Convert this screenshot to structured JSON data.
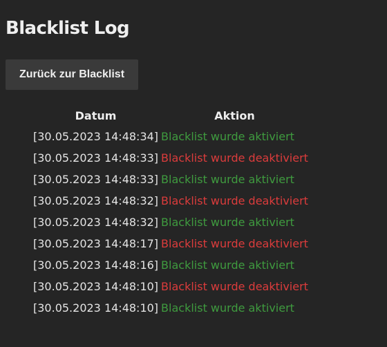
{
  "page": {
    "title": "Blacklist Log",
    "back_button_label": "Zurück zur Blacklist"
  },
  "table": {
    "headers": {
      "datum": "Datum",
      "aktion": "Aktion"
    },
    "rows": [
      {
        "timestamp": "[30.05.2023 14:48:34]",
        "action": "Blacklist wurde aktiviert",
        "status": "on"
      },
      {
        "timestamp": "[30.05.2023 14:48:33]",
        "action": "Blacklist wurde deaktiviert",
        "status": "off"
      },
      {
        "timestamp": "[30.05.2023 14:48:33]",
        "action": "Blacklist wurde aktiviert",
        "status": "on"
      },
      {
        "timestamp": "[30.05.2023 14:48:32]",
        "action": "Blacklist wurde deaktiviert",
        "status": "off"
      },
      {
        "timestamp": "[30.05.2023 14:48:32]",
        "action": "Blacklist wurde aktiviert",
        "status": "on"
      },
      {
        "timestamp": "[30.05.2023 14:48:17]",
        "action": "Blacklist wurde deaktiviert",
        "status": "off"
      },
      {
        "timestamp": "[30.05.2023 14:48:16]",
        "action": "Blacklist wurde aktiviert",
        "status": "on"
      },
      {
        "timestamp": "[30.05.2023 14:48:10]",
        "action": "Blacklist wurde deaktiviert",
        "status": "off"
      },
      {
        "timestamp": "[30.05.2023 14:48:10]",
        "action": "Blacklist wurde aktiviert",
        "status": "on"
      }
    ]
  },
  "colors": {
    "background": "#252525",
    "button_background": "#3a3a3a",
    "text": "#eeeeee",
    "activated": "#3f9b3f",
    "deactivated": "#dc3c3c"
  }
}
